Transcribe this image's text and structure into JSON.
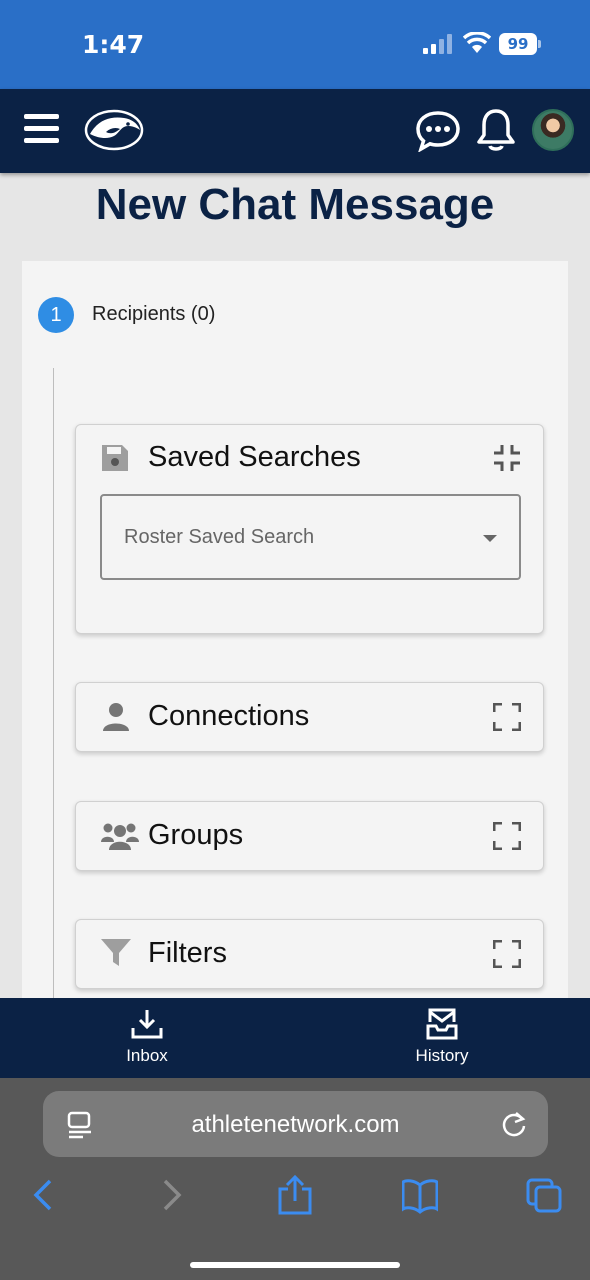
{
  "status_bar": {
    "time": "1:47",
    "battery": "99"
  },
  "header": {
    "menu_icon": "hamburger-menu-icon",
    "logo_icon": "nittany-lion-logo",
    "chat_icon": "chat-bubble-icon",
    "bell_icon": "bell-icon",
    "avatar_icon": "user-avatar"
  },
  "page": {
    "title": "New Chat Message"
  },
  "step": {
    "number": "1",
    "label": "Recipients (0)"
  },
  "panels": {
    "saved_searches": {
      "title": "Saved Searches",
      "icon": "floppy-disk-icon",
      "toggle_icon": "collapse-icon",
      "select_placeholder": "Roster Saved Search"
    },
    "connections": {
      "title": "Connections",
      "icon": "person-icon",
      "toggle_icon": "expand-icon"
    },
    "groups": {
      "title": "Groups",
      "icon": "people-group-icon",
      "toggle_icon": "expand-icon"
    },
    "filters": {
      "title": "Filters",
      "icon": "funnel-icon",
      "toggle_icon": "expand-icon"
    }
  },
  "bottom_nav": [
    {
      "label": "Inbox",
      "icon": "inbox-download-icon"
    },
    {
      "label": "History",
      "icon": "mail-tray-icon"
    }
  ],
  "browser": {
    "url": "athletenetwork.com",
    "toolbar": [
      "back-icon",
      "forward-icon",
      "share-icon",
      "bookmarks-icon",
      "tabs-icon"
    ]
  },
  "colors": {
    "status_bar": "#2a6fc7",
    "navy": "#0b2245",
    "accent": "#2f8de4"
  }
}
